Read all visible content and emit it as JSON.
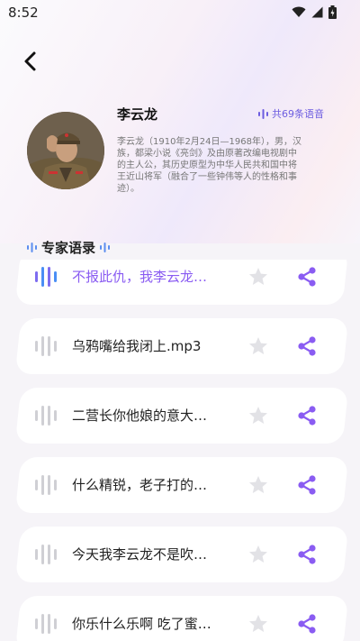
{
  "status": {
    "time": "8:52"
  },
  "profile": {
    "name": "李云龙",
    "count_label": "共69条语音",
    "description": "李云龙（1910年2月24日—1968年），男，汉族，都梁小说《亮剑》及由原著改编电视剧中的主人公，其历史原型为中华人民共和国中将王近山将军（融合了一些钟伟等人的性格和事迹）。"
  },
  "section": {
    "title": "专家语录"
  },
  "items": [
    {
      "title": "不报此仇，我李云龙…",
      "active": true
    },
    {
      "title": "乌鸦嘴给我闭上.mp3",
      "active": false
    },
    {
      "title": "二营长你他娘的意大…",
      "active": false
    },
    {
      "title": "什么精锐，老子打的…",
      "active": false
    },
    {
      "title": "今天我李云龙不是吹…",
      "active": false
    },
    {
      "title": "你乐什么乐啊 吃了蜜…",
      "active": false
    }
  ],
  "colors": {
    "accent": "#8a5cf2",
    "icon_gray": "#cfcfd4",
    "star_gray": "#e2e2e6"
  }
}
